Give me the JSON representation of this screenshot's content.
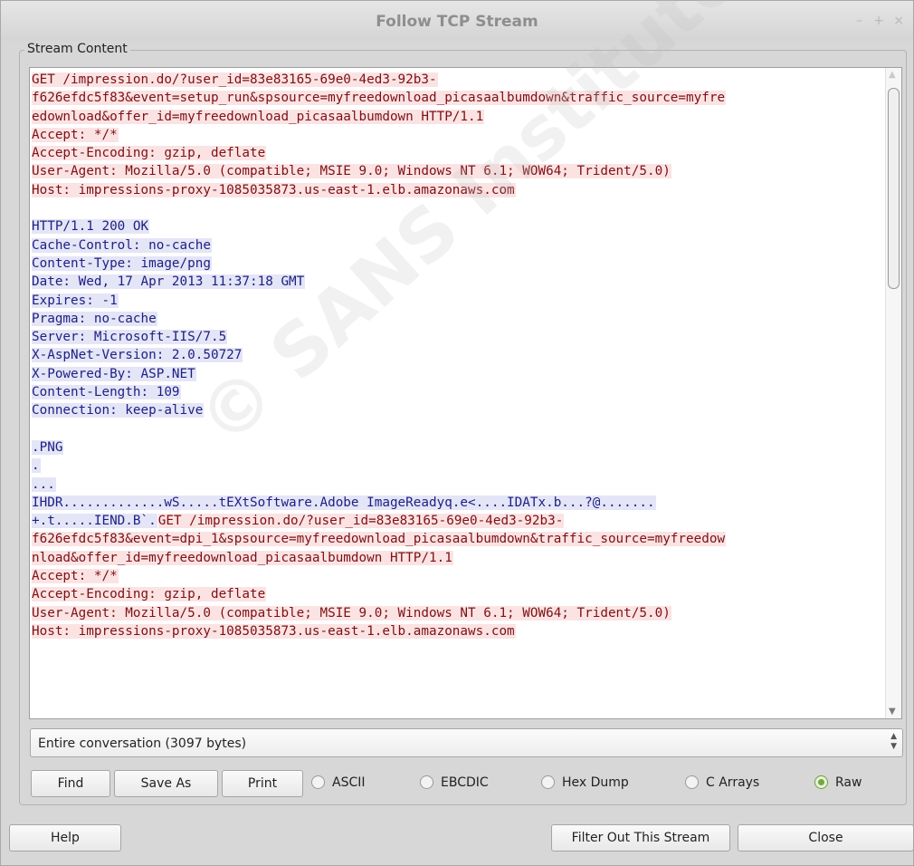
{
  "window": {
    "title": "Follow TCP Stream",
    "controls": {
      "minimize": "–",
      "maximize": "+",
      "close": "×"
    }
  },
  "group_label": "Stream Content",
  "stream_lines": [
    {
      "dir": "c",
      "text": "GET /impression.do/?user_id=83e83165-69e0-4ed3-92b3-"
    },
    {
      "dir": "c",
      "text": "f626efdc5f83&event=setup_run&spsource=myfreedownload_picasaalbumdown&traffic_source=myfre"
    },
    {
      "dir": "c",
      "text": "edownload&offer_id=myfreedownload_picasaalbumdown HTTP/1.1"
    },
    {
      "dir": "c",
      "text": "Accept: */*"
    },
    {
      "dir": "c",
      "text": "Accept-Encoding: gzip, deflate"
    },
    {
      "dir": "c",
      "text": "User-Agent: Mozilla/5.0 (compatible; MSIE 9.0; Windows NT 6.1; WOW64; Trident/5.0)"
    },
    {
      "dir": "c",
      "text": "Host: impressions-proxy-1085035873.us-east-1.elb.amazonaws.com"
    },
    {
      "dir": "blank",
      "text": ""
    },
    {
      "dir": "s",
      "text": "HTTP/1.1 200 OK"
    },
    {
      "dir": "s",
      "text": "Cache-Control: no-cache"
    },
    {
      "dir": "s",
      "text": "Content-Type: image/png"
    },
    {
      "dir": "s",
      "text": "Date: Wed, 17 Apr 2013 11:37:18 GMT"
    },
    {
      "dir": "s",
      "text": "Expires: -1"
    },
    {
      "dir": "s",
      "text": "Pragma: no-cache"
    },
    {
      "dir": "s",
      "text": "Server: Microsoft-IIS/7.5"
    },
    {
      "dir": "s",
      "text": "X-AspNet-Version: 2.0.50727"
    },
    {
      "dir": "s",
      "text": "X-Powered-By: ASP.NET"
    },
    {
      "dir": "s",
      "text": "Content-Length: 109"
    },
    {
      "dir": "s",
      "text": "Connection: keep-alive"
    },
    {
      "dir": "blank",
      "text": ""
    },
    {
      "dir": "s",
      "text": ".PNG"
    },
    {
      "dir": "s",
      "text": "."
    },
    {
      "dir": "s",
      "text": "..."
    },
    {
      "dir": "s",
      "text": "IHDR.............wS.....tEXtSoftware.Adobe ImageReadyq.e<....IDATx.b...?@......."
    },
    {
      "dir": "s",
      "text": "+.t.....IEND.B`.",
      "tail_dir": "c",
      "tail": "GET /impression.do/?user_id=83e83165-69e0-4ed3-92b3-"
    },
    {
      "dir": "c",
      "text": "f626efdc5f83&event=dpi_1&spsource=myfreedownload_picasaalbumdown&traffic_source=myfreedow"
    },
    {
      "dir": "c",
      "text": "nload&offer_id=myfreedownload_picasaalbumdown HTTP/1.1"
    },
    {
      "dir": "c",
      "text": "Accept: */*"
    },
    {
      "dir": "c",
      "text": "Accept-Encoding: gzip, deflate"
    },
    {
      "dir": "c",
      "text": "User-Agent: Mozilla/5.0 (compatible; MSIE 9.0; Windows NT 6.1; WOW64; Trident/5.0)"
    },
    {
      "dir": "c",
      "text": "Host: impressions-proxy-1085035873.us-east-1.elb.amazonaws.com"
    }
  ],
  "dropdown": {
    "selected": "Entire conversation (3097 bytes)"
  },
  "buttons": {
    "find": "Find",
    "save_as": "Save As",
    "print": "Print",
    "help": "Help",
    "filter_out": "Filter Out This Stream",
    "close": "Close"
  },
  "formats": [
    {
      "label": "ASCII",
      "selected": false
    },
    {
      "label": "EBCDIC",
      "selected": false
    },
    {
      "label": "Hex Dump",
      "selected": false
    },
    {
      "label": "C Arrays",
      "selected": false
    },
    {
      "label": "Raw",
      "selected": true
    }
  ],
  "watermark": "© SANS Institute, Author retains full rights.",
  "colors": {
    "client_bg": "#fbe3e3",
    "client_fg": "#7d1015",
    "server_bg": "#e4e5f6",
    "server_fg": "#1d1f83",
    "radio_on": "#72a83d"
  }
}
